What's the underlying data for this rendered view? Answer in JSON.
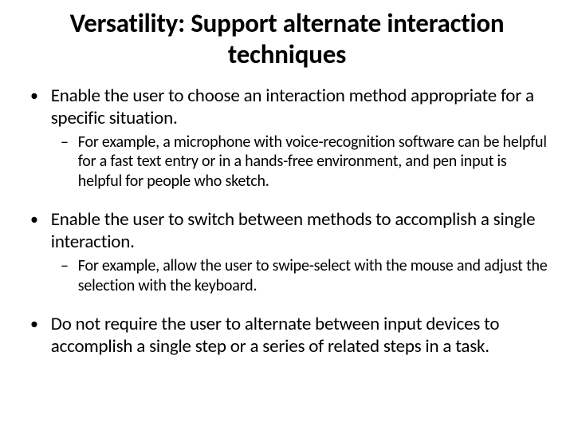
{
  "title": "Versatility: Support alternate interaction techniques",
  "bullets": [
    {
      "text": "Enable the user to choose an interaction method appropriate for a specific situation.",
      "sub": "For example, a microphone with voice-recognition software can be helpful for a fast text entry or in a hands-free environment, and pen input is helpful for people who sketch."
    },
    {
      "text": " Enable the user to switch between methods to accomplish a single interaction.",
      "sub": "For example, allow the user to swipe-select with the mouse and adjust the selection with the keyboard."
    },
    {
      "text": " Do not require the user to alternate between input devices to accomplish a single step or a series of related steps in a task.",
      "sub": null
    }
  ]
}
